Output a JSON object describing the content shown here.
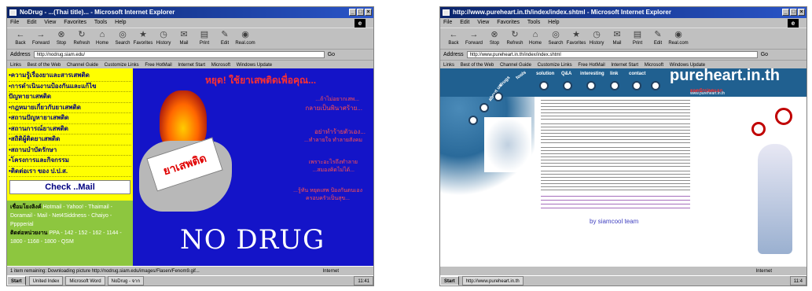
{
  "left_window": {
    "title": "NoDrug - ...(Thai title)... - Microsoft Internet Explorer",
    "menu": [
      "File",
      "Edit",
      "View",
      "Favorites",
      "Tools",
      "Help"
    ],
    "toolbar": [
      "Back",
      "Forward",
      "Stop",
      "Refresh",
      "Home",
      "Search",
      "Favorites",
      "History",
      "Mail",
      "Print",
      "Edit",
      "Real.com"
    ],
    "address_label": "Address",
    "address": "http://nodrug.siam.edu/",
    "go_label": "Go",
    "links": [
      "Links",
      "Best of the Web",
      "Channel Guide",
      "Customize Links",
      "Free HotMail",
      "Internet Start",
      "Microsoft",
      "Windows Update"
    ],
    "sidebar_items": [
      "•ความรู้เรื่องยาและสารเสพติด",
      "•การดำเนินงานป้องกันและแก้ไข",
      "ปัญหายาเสพติด",
      "•กฎหมายเกี่ยวกับยาเสพติด",
      "•สถานปัญหายาเสพติด",
      "•สถานการณ์ยาเสพติด",
      "•สถิติผู้ติดยาเสพติด",
      "•สถานบำบัดรักษา",
      "•โครงการและกิจกรรม",
      "•ติดต่อเรา ของ ป.ป.ส."
    ],
    "check_mail": "Check ..Mail",
    "green_links_label": "เชื่อมโยงลิงค์",
    "green_links": "Hotmail - Yahoo! - Thaimail - Doramail - Mail - Net4Siddness - Chaiyo - Pppperial",
    "green_contact_label": "ติดต่อหน่วยงาน",
    "green_contact": "PPA - 142 - 152 - 162 - 1144 - 1800 - 1168 - 1800 - QSM",
    "headline": "หยุด! ใช้ยาเสพติดเพื่อคุณ...",
    "text1": "...ถ้าไม่อยากเสพ...",
    "text1b": "กลายเป็นพินาศร้าย...",
    "text2": "อย่าทำร้ายตัวเอง...",
    "text2b": "...ทำลายใจ ทำลายสังคม",
    "text3": "เพราะอะไรถึงทำลาย",
    "text3b": "...สมองคิดไม่ได้...",
    "text4": "...รู้ทัน หยุดเสพ ป้องกันตนเอง",
    "text4b": "ครอบครัวเป็นสุข...",
    "card": "ยาเสพติด",
    "nodrug": "NO DRUG",
    "status": "1 item remaining: Downloading picture http://nodrug.siam.edu/images/Flasen/Fenom9.gif...",
    "status_zone": "Internet",
    "taskbar": [
      "Start",
      "United Index",
      "Microsoft Word",
      "NoDrug - จาก"
    ],
    "tray": "11:41"
  },
  "right_window": {
    "title": "http://www.pureheart.in.th/index/index.shtml - Microsoft Internet Explorer",
    "menu": [
      "File",
      "Edit",
      "View",
      "Favorites",
      "Tools",
      "Help"
    ],
    "toolbar": [
      "Back",
      "Forward",
      "Stop",
      "Refresh",
      "Home",
      "Search",
      "Favorites",
      "History",
      "Mail",
      "Print",
      "Edit",
      "Real.com"
    ],
    "address_label": "Address",
    "address": "http://www.pureheart.in.th/index/index.shtml",
    "go_label": "Go",
    "links": [
      "Links",
      "Best of the Web",
      "Channel Guide",
      "Customize Links",
      "Free HotMail",
      "Internet Start",
      "Microsoft",
      "Windows Update"
    ],
    "nav": [
      "about us",
      "drugs",
      "tools",
      "solution",
      "Q&A",
      "interesting",
      "link",
      "contact"
    ],
    "logo": "pureheart.in.th",
    "logo_sub": "ยอดนักปลดแอก",
    "logo_sub2": "www.pureheart.in.th",
    "team": "by siamcool team",
    "status_zone": "Internet",
    "taskbar": [
      "Start",
      "http://www.pureheart.in.th"
    ],
    "tray": "11:4"
  }
}
